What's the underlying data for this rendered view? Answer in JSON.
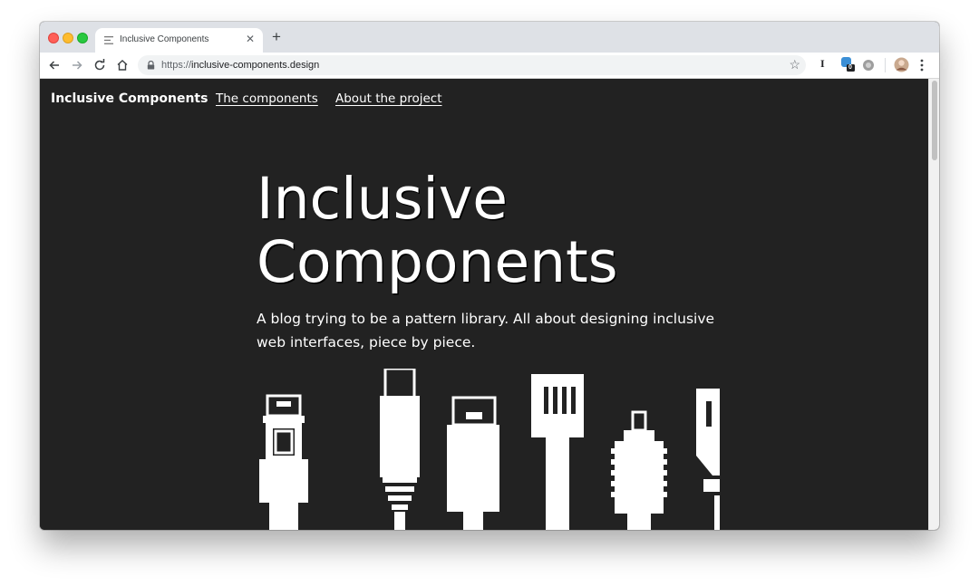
{
  "browser": {
    "tab": {
      "title": "Inclusive Components",
      "close_icon": "close-icon",
      "favicon": "page-icon"
    },
    "new_tab_label": "+",
    "url": {
      "scheme": "https://",
      "host": "inclusive-components.design"
    },
    "bookmark_star": "☆",
    "extensions": {
      "instapaper_label": "I",
      "badge_count": "0"
    }
  },
  "site": {
    "brand": "Inclusive Components",
    "nav": {
      "components": "The components",
      "about": "About the project"
    },
    "hero": {
      "title_line1": "Inclusive",
      "title_line2": "Components",
      "subtitle": "A blog trying to be a pattern library. All about designing inclusive web interfaces, piece by piece."
    }
  },
  "colors": {
    "page_background": "#222222",
    "text": "#ffffff",
    "chrome_tabstrip": "#dee1e6"
  }
}
